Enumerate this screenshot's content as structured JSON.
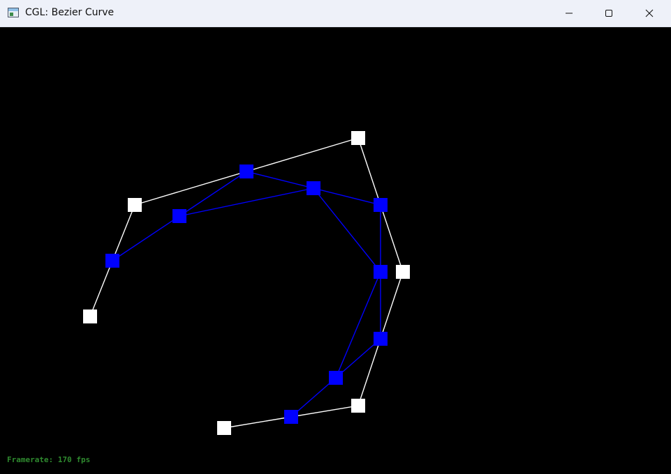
{
  "window": {
    "title": "CGL: Bezier Curve",
    "icon": "app-window-icon",
    "controls": {
      "minimize_icon": "minimize-icon",
      "maximize_icon": "maximize-icon",
      "close_icon": "close-icon"
    }
  },
  "colors": {
    "background": "#000000",
    "control_point": "#ffffff",
    "control_polygon": "#ffffff",
    "subdivision_point": "#0000ff",
    "subdivision_line": "#0000ff",
    "framerate_text": "#2f8a2f"
  },
  "status": {
    "framerate_label": "Framerate: 170 fps"
  }
}
